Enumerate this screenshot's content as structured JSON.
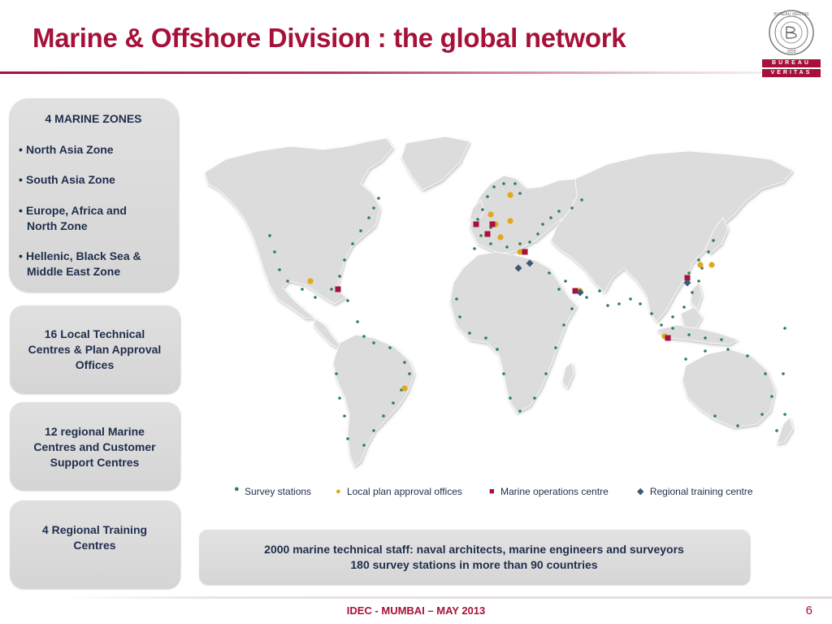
{
  "title": "Marine & Offshore Division : the global network",
  "logo": {
    "ring_text": "BUREAU VERITAS",
    "year": "1828",
    "band_top": "BUREAU",
    "band_bottom": "VERITAS",
    "color": "#a6113a"
  },
  "zones": {
    "heading": "4 MARINE ZONES",
    "items": [
      {
        "line1": "North Asia Zone",
        "line2": ""
      },
      {
        "line1": "South Asia Zone",
        "line2": ""
      },
      {
        "line1": "Europe, Africa and",
        "line2": "North Zone"
      },
      {
        "line1": "Hellenic, Black Sea &",
        "line2": "Middle East Zone"
      }
    ]
  },
  "boxes": [
    {
      "lines": [
        "16 Local Technical",
        "Centres & Plan Approval",
        "Offices"
      ]
    },
    {
      "lines": [
        "12 regional Marine",
        "Centres and Customer",
        "Support Centres"
      ]
    },
    {
      "lines": [
        "4 Regional Training",
        "Centres"
      ]
    }
  ],
  "legend": [
    {
      "label": "Survey stations",
      "icon": "small-dot-icon",
      "color": "#2e7d5b"
    },
    {
      "label": "Local plan approval offices",
      "icon": "circle-icon",
      "color": "#e0a81a"
    },
    {
      "label": "Marine operations centre",
      "icon": "square-icon",
      "color": "#a6113a"
    },
    {
      "label": "Regional training centre",
      "icon": "diamond-icon",
      "color": "#3b5a78"
    }
  ],
  "stats": {
    "line1": "2000 marine technical staff: naval architects, marine engineers and surveyors",
    "line2": "180 survey stations in more than 90 countries"
  },
  "footer": "IDEC - MUMBAI – MAY 2013",
  "page_number": "6"
}
